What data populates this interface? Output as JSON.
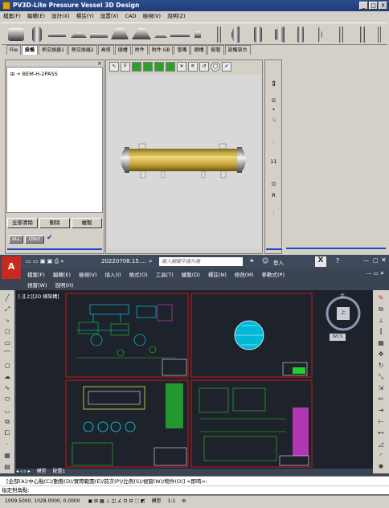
{
  "pv3d": {
    "title": "PV3D-Lite Pressure Vessel 3D Design",
    "window_controls": [
      "_",
      "□",
      "X"
    ],
    "menu": [
      "檔案(F)",
      "編輯(E)",
      "設計(X)",
      "標註(Y)",
      "設置(X)",
      "CAD",
      "檢視(V)",
      "說明(Z)"
    ],
    "tabs": [
      "File",
      "設備",
      "熱交換器1",
      "熱交換器2",
      "高塔",
      "儲槽",
      "附件",
      "附件 GB",
      "管嘴",
      "鋼構",
      "配管",
      "設備架台"
    ],
    "active_tab_index": 1,
    "tree_item": "BEM-H-2PASS",
    "buttons": {
      "clear_all": "全部清除",
      "delete": "刪除",
      "copy": "複製"
    },
    "filters": {
      "all": "ALL",
      "only": "ONLY"
    },
    "right_bar": [
      "G",
      "*",
      "11",
      "O",
      "R"
    ],
    "colors": {
      "shell": "#c9a640",
      "nozzle": "#e0e0e0",
      "canvas": "#d8d8d8"
    }
  },
  "cad": {
    "file_name": "20220708.15....",
    "search_placeholder": "鍵入關鍵字或片語",
    "login": "登入",
    "menu_row1": [
      "檔案(F)",
      "編輯(E)",
      "檢視(V)",
      "插入(I)",
      "格式(O)",
      "工具(T)",
      "繪製(D)",
      "標註(N)",
      "修改(M)",
      "參數式(P)"
    ],
    "menu_row2": [
      "視窗(W)",
      "說明(H)"
    ],
    "view_label": "[-][上][2D 線架構]",
    "compass": {
      "top": "北",
      "center": "上",
      "wcs": "WCS"
    },
    "layout_tabs": [
      "模型",
      "配置1"
    ],
    "command_line": "[全部(A)/中心點(C)/動態(D)/實際範圍(E)/前次(P)/比例(S)/視窗(W)/物件(O)] <即時>:",
    "command_prompt": "指定對角點:",
    "coordinates": "1009.5000, 1028.0000, 0.0000",
    "status_model": "模型",
    "status_scale": "1:1",
    "colors": {
      "draw_bg": "#1e222b",
      "frame": "#c41818",
      "line_cyan": "#00e5ff",
      "line_green": "#22cc33",
      "line_magenta": "#e040e0",
      "line_yellow": "#ffff44",
      "line_white": "#e8e8e8"
    }
  }
}
